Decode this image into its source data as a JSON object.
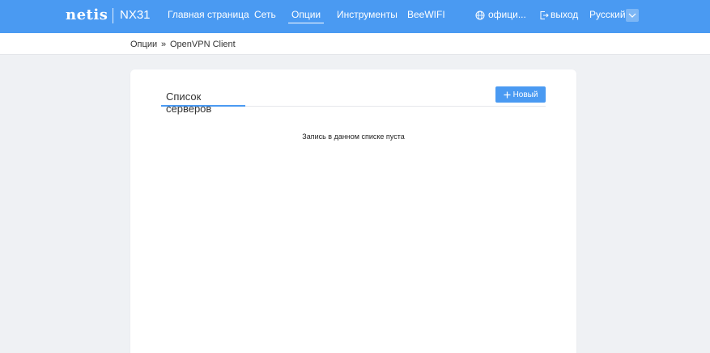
{
  "header": {
    "brand": "netis",
    "model": "NX31",
    "nav": [
      {
        "label": "Главная страница",
        "active": false
      },
      {
        "label": "Сеть",
        "active": false
      },
      {
        "label": "Опции",
        "active": true
      },
      {
        "label": "Инструменты",
        "active": false
      },
      {
        "label": "BeeWIFI",
        "active": false
      }
    ],
    "official_label": "офици...",
    "logout_label": "выход",
    "language": "Русский"
  },
  "breadcrumb": {
    "parent": "Опции",
    "separator": "»",
    "current": "OpenVPN Client"
  },
  "card": {
    "tab_label": "Список серверов",
    "add_button_label": "Новый",
    "empty_message": "Запись в данном списке пуста"
  },
  "colors": {
    "primary": "#4a9af2",
    "page_background": "#eff1f4"
  }
}
